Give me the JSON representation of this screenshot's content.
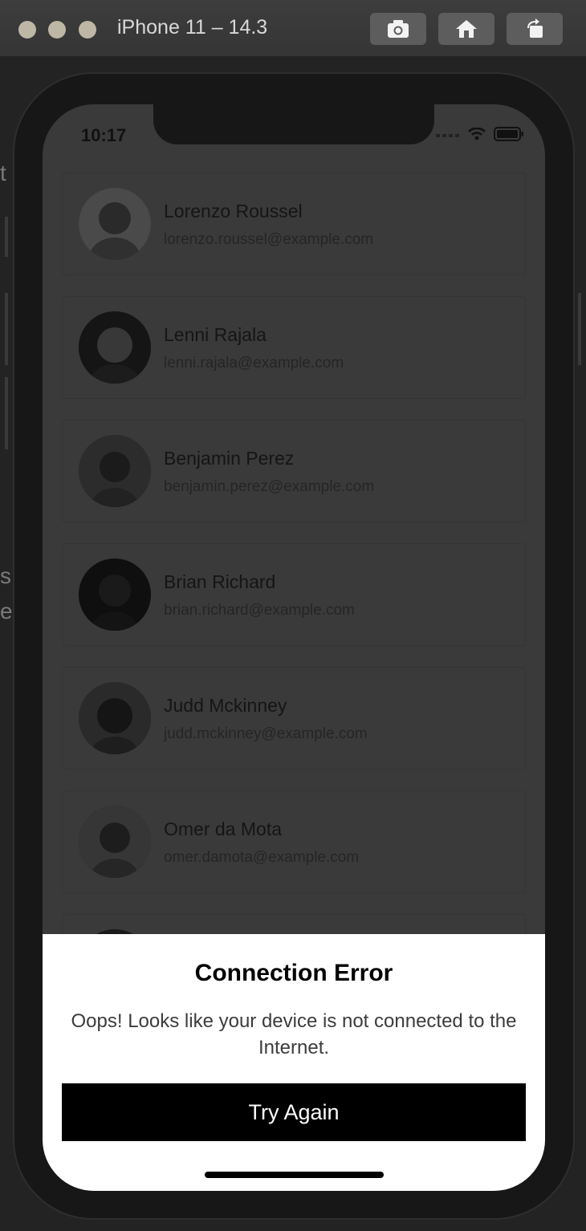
{
  "window": {
    "title": "iPhone 11 – 14.3",
    "toolbar": [
      "screenshot-icon",
      "home-icon",
      "rotate-icon"
    ]
  },
  "status_bar": {
    "time": "10:17"
  },
  "users": [
    {
      "name": "Lorenzo Roussel",
      "email": "lorenzo.roussel@example.com"
    },
    {
      "name": "Lenni Rajala",
      "email": "lenni.rajala@example.com"
    },
    {
      "name": "Benjamin Perez",
      "email": "benjamin.perez@example.com"
    },
    {
      "name": "Brian Richard",
      "email": "brian.richard@example.com"
    },
    {
      "name": "Judd Mckinney",
      "email": "judd.mckinney@example.com"
    },
    {
      "name": "Omer da Mota",
      "email": "omer.damota@example.com"
    }
  ],
  "error_sheet": {
    "title": "Connection Error",
    "message": "Oops! Looks like your device is not connected to the Internet.",
    "button_label": "Try Again"
  },
  "colors": {
    "overlay": "#3a3a3a",
    "sheet_bg": "#ffffff",
    "button_bg": "#000000",
    "button_text": "#ffffff"
  }
}
